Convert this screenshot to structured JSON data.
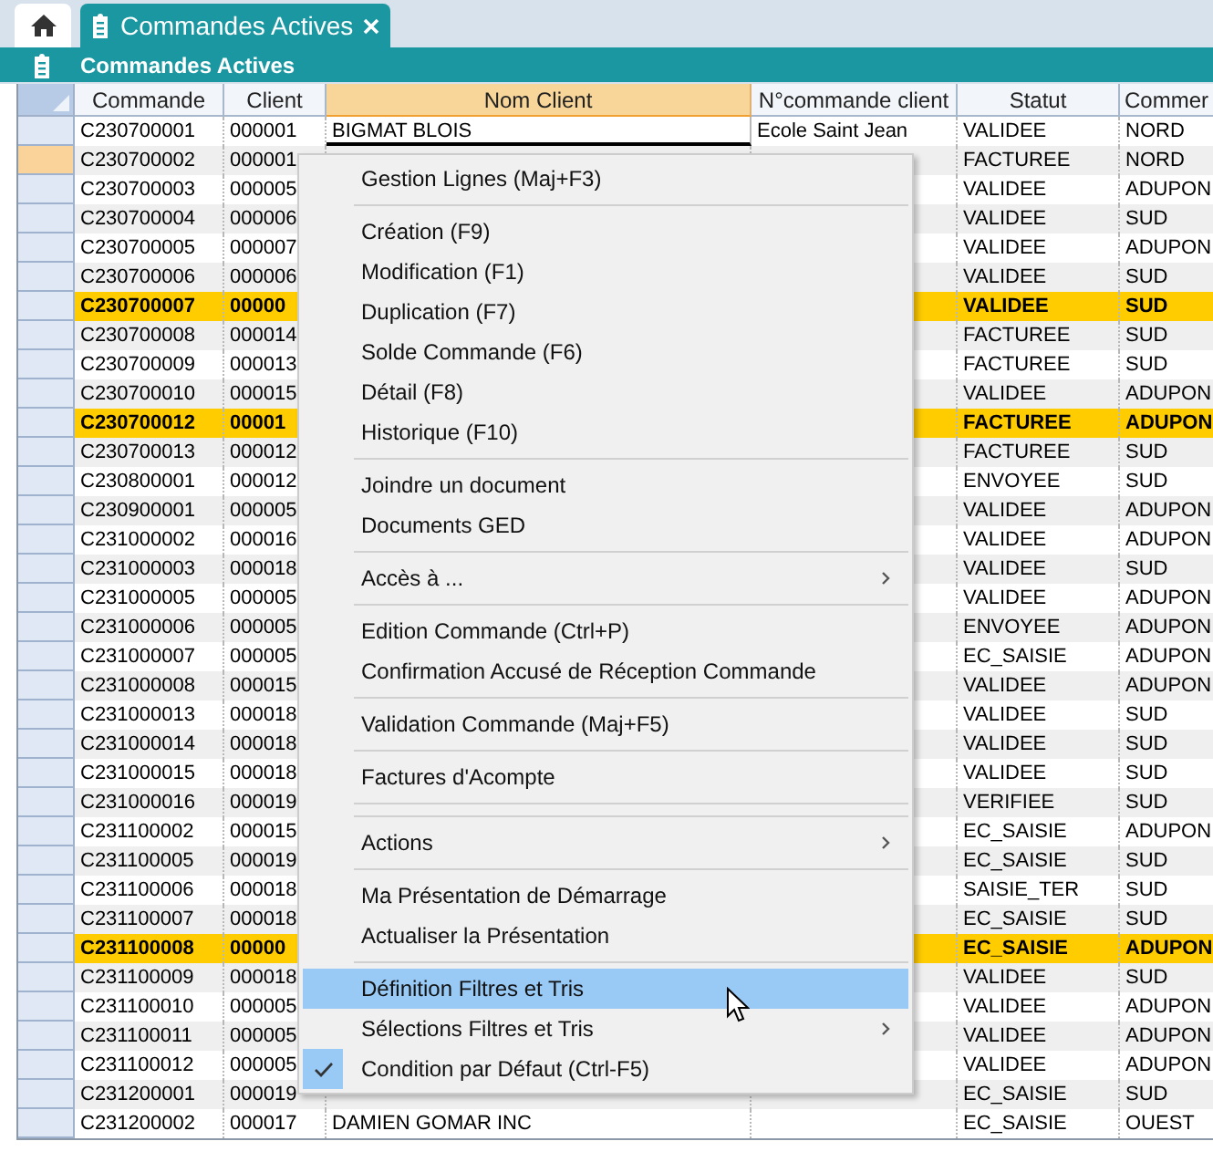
{
  "tabs": [
    {
      "kind": "home",
      "selected": false
    },
    {
      "kind": "document",
      "label": "Commandes Actives",
      "selected": true
    }
  ],
  "view_title": "Commandes Actives",
  "table": {
    "columns": [
      {
        "label": "Commande",
        "selected": false
      },
      {
        "label": "Client",
        "selected": false
      },
      {
        "label": "Nom Client",
        "selected": true
      },
      {
        "label": "N°commande client",
        "selected": false
      },
      {
        "label": "Statut",
        "selected": false
      },
      {
        "label": "Commer",
        "selected": false
      }
    ],
    "rows": [
      {
        "commande": "C230700001",
        "client": "000001",
        "nom_client": "BIGMAT BLOIS",
        "n_commande_client": "Ecole Saint Jean",
        "statut": "VALIDEE",
        "commercial": "NORD",
        "highlighted": false,
        "current": false
      },
      {
        "commande": "C230700002",
        "client": "000001",
        "statut": "FACTUREE",
        "commercial": "NORD",
        "highlighted": false,
        "current": true
      },
      {
        "commande": "C230700003",
        "client": "000005",
        "statut": "VALIDEE",
        "commercial": "ADUPON",
        "highlighted": false,
        "current": false
      },
      {
        "commande": "C230700004",
        "client": "000006",
        "statut": "VALIDEE",
        "commercial": "SUD",
        "highlighted": false,
        "current": false
      },
      {
        "commande": "C230700005",
        "client": "000007",
        "statut": "VALIDEE",
        "commercial": "ADUPON",
        "highlighted": false,
        "current": false
      },
      {
        "commande": "C230700006",
        "client": "000006",
        "statut": "VALIDEE",
        "commercial": "SUD",
        "highlighted": false,
        "current": false
      },
      {
        "commande": "C230700007",
        "client": "00000",
        "statut": "VALIDEE",
        "commercial": "SUD",
        "highlighted": true,
        "current": false
      },
      {
        "commande": "C230700008",
        "client": "000014",
        "statut": "FACTUREE",
        "commercial": "SUD",
        "highlighted": false,
        "current": false
      },
      {
        "commande": "C230700009",
        "client": "000013",
        "statut": "FACTUREE",
        "commercial": "SUD",
        "highlighted": false,
        "current": false
      },
      {
        "commande": "C230700010",
        "client": "000015",
        "statut": "VALIDEE",
        "commercial": "ADUPON",
        "highlighted": false,
        "current": false
      },
      {
        "commande": "C230700012",
        "client": "00001",
        "statut": "FACTUREE",
        "commercial": "ADUPON",
        "highlighted": true,
        "current": false
      },
      {
        "commande": "C230700013",
        "client": "000012",
        "statut": "FACTUREE",
        "commercial": "SUD",
        "highlighted": false,
        "current": false
      },
      {
        "commande": "C230800001",
        "client": "000012",
        "statut": "ENVOYEE",
        "commercial": "SUD",
        "highlighted": false,
        "current": false
      },
      {
        "commande": "C230900001",
        "client": "000005",
        "statut": "VALIDEE",
        "commercial": "ADUPON",
        "highlighted": false,
        "current": false
      },
      {
        "commande": "C231000002",
        "client": "000016",
        "statut": "VALIDEE",
        "commercial": "ADUPON",
        "highlighted": false,
        "current": false
      },
      {
        "commande": "C231000003",
        "client": "000018",
        "statut": "VALIDEE",
        "commercial": "SUD",
        "highlighted": false,
        "current": false
      },
      {
        "commande": "C231000005",
        "client": "000005",
        "statut": "VALIDEE",
        "commercial": "ADUPON",
        "highlighted": false,
        "current": false
      },
      {
        "commande": "C231000006",
        "client": "000005",
        "statut": "ENVOYEE",
        "commercial": "ADUPON",
        "highlighted": false,
        "current": false
      },
      {
        "commande": "C231000007",
        "client": "000005",
        "statut": "EC_SAISIE",
        "commercial": "ADUPON",
        "highlighted": false,
        "current": false
      },
      {
        "commande": "C231000008",
        "client": "000015",
        "statut": "VALIDEE",
        "commercial": "ADUPON",
        "highlighted": false,
        "current": false
      },
      {
        "commande": "C231000013",
        "client": "000018",
        "statut": "VALIDEE",
        "commercial": "SUD",
        "highlighted": false,
        "current": false
      },
      {
        "commande": "C231000014",
        "client": "000018",
        "statut": "VALIDEE",
        "commercial": "SUD",
        "highlighted": false,
        "current": false
      },
      {
        "commande": "C231000015",
        "client": "000018",
        "statut": "VALIDEE",
        "commercial": "SUD",
        "highlighted": false,
        "current": false
      },
      {
        "commande": "C231000016",
        "client": "000019",
        "statut": "VERIFIEE",
        "commercial": "SUD",
        "highlighted": false,
        "current": false
      },
      {
        "commande": "C231100002",
        "client": "000015",
        "statut": "EC_SAISIE",
        "commercial": "ADUPON",
        "highlighted": false,
        "current": false
      },
      {
        "commande": "C231100005",
        "client": "000019",
        "statut": "EC_SAISIE",
        "commercial": "SUD",
        "highlighted": false,
        "current": false
      },
      {
        "commande": "C231100006",
        "client": "000018",
        "statut": "SAISIE_TER",
        "commercial": "SUD",
        "highlighted": false,
        "current": false
      },
      {
        "commande": "C231100007",
        "client": "000018",
        "statut": "EC_SAISIE",
        "commercial": "SUD",
        "highlighted": false,
        "current": false
      },
      {
        "commande": "C231100008",
        "client": "00000",
        "statut": "EC_SAISIE",
        "commercial": "ADUPON",
        "highlighted": true,
        "current": false
      },
      {
        "commande": "C231100009",
        "client": "000018",
        "statut": "VALIDEE",
        "commercial": "SUD",
        "highlighted": false,
        "current": false
      },
      {
        "commande": "C231100010",
        "client": "000005",
        "statut": "VALIDEE",
        "commercial": "ADUPON",
        "highlighted": false,
        "current": false
      },
      {
        "commande": "C231100011",
        "client": "000005",
        "statut": "VALIDEE",
        "commercial": "ADUPON",
        "highlighted": false,
        "current": false
      },
      {
        "commande": "C231100012",
        "client": "000005",
        "statut": "VALIDEE",
        "commercial": "ADUPON",
        "highlighted": false,
        "current": false
      },
      {
        "commande": "C231200001",
        "client": "000019",
        "statut": "EC_SAISIE",
        "commercial": "SUD",
        "highlighted": false,
        "current": false
      },
      {
        "commande": "C231200002",
        "client": "000017",
        "nom_client": "DAMIEN GOMAR INC",
        "statut": "EC_SAISIE",
        "commercial": "OUEST",
        "highlighted": false,
        "current": false
      }
    ]
  },
  "context_menu": {
    "items": [
      {
        "kind": "item",
        "label": "Gestion Lignes (Maj+F3)",
        "submenu": false,
        "checked": false,
        "selected": false
      },
      {
        "kind": "separator"
      },
      {
        "kind": "item",
        "label": "Création (F9)",
        "submenu": false,
        "checked": false,
        "selected": false
      },
      {
        "kind": "item",
        "label": "Modification (F1)",
        "submenu": false,
        "checked": false,
        "selected": false
      },
      {
        "kind": "item",
        "label": "Duplication (F7)",
        "submenu": false,
        "checked": false,
        "selected": false
      },
      {
        "kind": "item",
        "label": "Solde Commande (F6)",
        "submenu": false,
        "checked": false,
        "selected": false
      },
      {
        "kind": "item",
        "label": "Détail (F8)",
        "submenu": false,
        "checked": false,
        "selected": false
      },
      {
        "kind": "item",
        "label": "Historique (F10)",
        "submenu": false,
        "checked": false,
        "selected": false
      },
      {
        "kind": "separator"
      },
      {
        "kind": "item",
        "label": "Joindre un document",
        "submenu": false,
        "checked": false,
        "selected": false
      },
      {
        "kind": "item",
        "label": "Documents GED",
        "submenu": false,
        "checked": false,
        "selected": false
      },
      {
        "kind": "separator"
      },
      {
        "kind": "item",
        "label": "Accès à ...",
        "submenu": true,
        "checked": false,
        "selected": false
      },
      {
        "kind": "separator"
      },
      {
        "kind": "item",
        "label": "Edition Commande (Ctrl+P)",
        "submenu": false,
        "checked": false,
        "selected": false
      },
      {
        "kind": "item",
        "label": "Confirmation Accusé de Réception Commande",
        "submenu": false,
        "checked": false,
        "selected": false
      },
      {
        "kind": "separator"
      },
      {
        "kind": "item",
        "label": "Validation Commande (Maj+F5)",
        "submenu": false,
        "checked": false,
        "selected": false
      },
      {
        "kind": "separator"
      },
      {
        "kind": "item",
        "label": "Factures d'Acompte",
        "submenu": false,
        "checked": false,
        "selected": false
      },
      {
        "kind": "separator"
      },
      {
        "kind": "separator"
      },
      {
        "kind": "item",
        "label": "Actions",
        "submenu": true,
        "checked": false,
        "selected": false
      },
      {
        "kind": "separator"
      },
      {
        "kind": "item",
        "label": "Ma Présentation de Démarrage",
        "submenu": false,
        "checked": false,
        "selected": false
      },
      {
        "kind": "item",
        "label": "Actualiser la Présentation",
        "submenu": false,
        "checked": false,
        "selected": false
      },
      {
        "kind": "separator"
      },
      {
        "kind": "item",
        "label": "Définition Filtres et Tris",
        "submenu": false,
        "checked": false,
        "selected": true
      },
      {
        "kind": "item",
        "label": "Sélections Filtres et Tris",
        "submenu": true,
        "checked": false,
        "selected": false
      },
      {
        "kind": "item",
        "label": "Condition par Défaut (Ctrl-F5)",
        "submenu": false,
        "checked": true,
        "selected": false
      }
    ]
  }
}
